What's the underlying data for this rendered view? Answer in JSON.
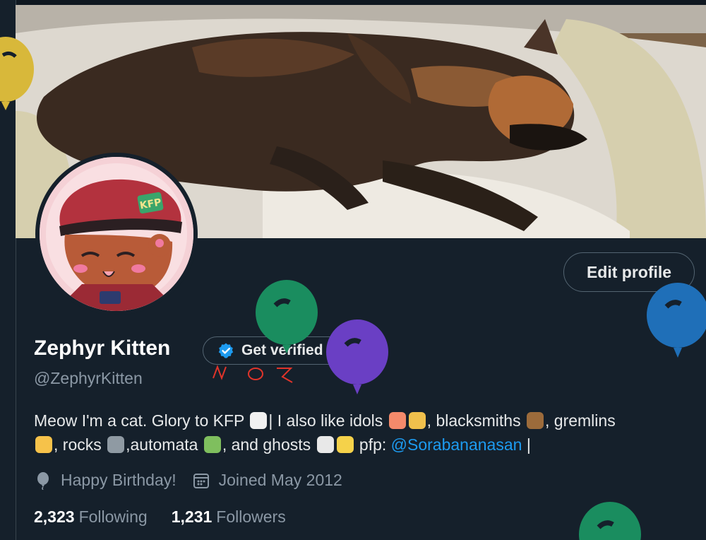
{
  "profile": {
    "display_name": "Zephyr Kitten",
    "handle": "@ZephyrKitten",
    "verify_label": "Get verified",
    "edit_label": "Edit profile",
    "bio_text_1": "Meow I'm a cat. Glory to KFP ",
    "bio_text_2": "| I also like idols ",
    "bio_text_3": ",  blacksmiths ",
    "bio_text_4": ", gremlins",
    "bio_text_5": ", rocks ",
    "bio_text_6": ",automata ",
    "bio_text_7": ", and ghosts ",
    "bio_text_8": " pfp: ",
    "bio_link": "@Sorabananasan",
    "bio_end": " |",
    "birthday": "Happy Birthday!",
    "joined": "Joined May 2012",
    "following_count": "2,323",
    "following_label": "Following",
    "followers_count": "1,231",
    "followers_label": "Followers",
    "avatar_badge": "KFP"
  },
  "icons": [
    "verified-badge-icon",
    "balloon-icon",
    "calendar-icon"
  ],
  "colors": {
    "background": "#15202b",
    "accent": "#1d9bf0",
    "muted": "#8b98a5",
    "balloon_green": "#1a8d5f",
    "balloon_purple": "#6a3fc4",
    "balloon_blue": "#1f6fb8",
    "balloon_yellow": "#d8b83a"
  }
}
